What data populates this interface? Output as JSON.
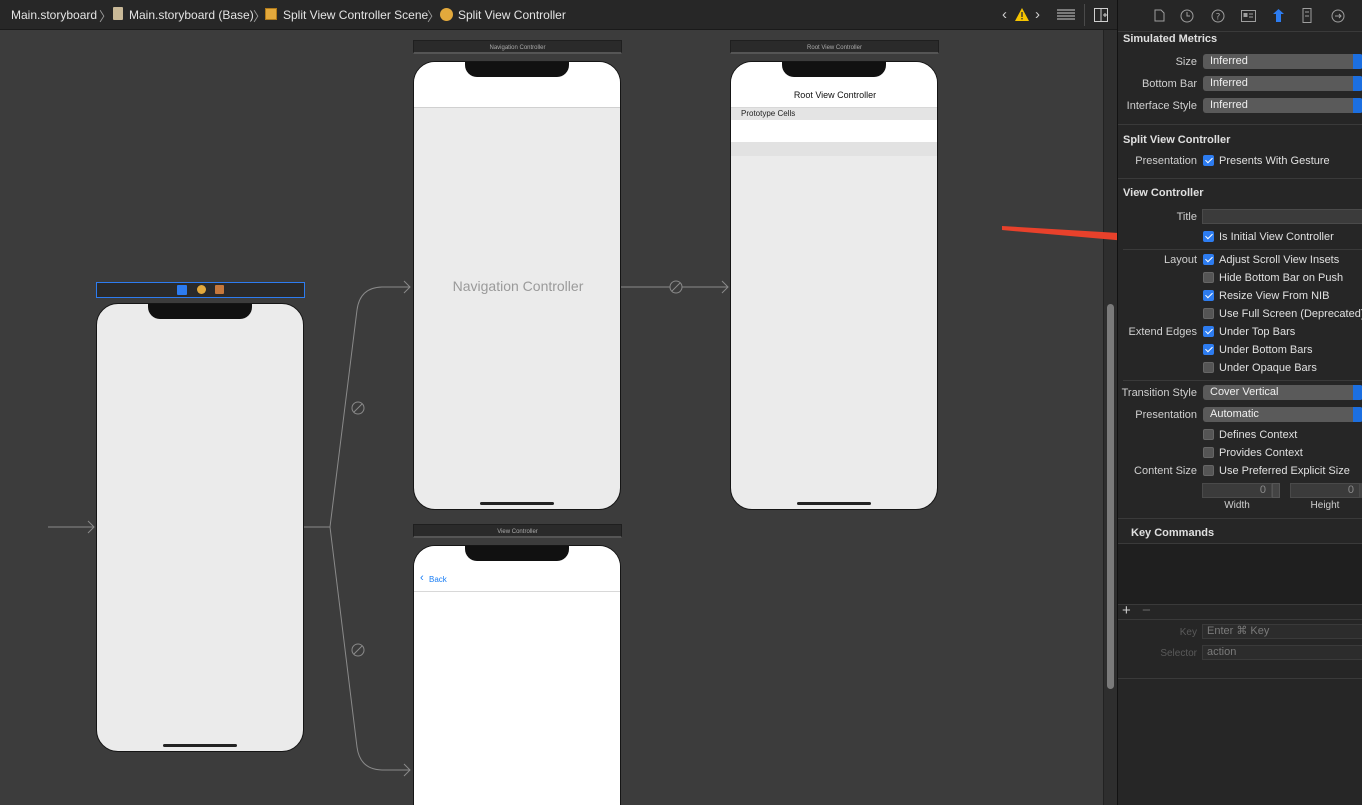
{
  "breadcrumb": {
    "items": [
      "Main.storyboard",
      "Main.storyboard (Base)",
      "Split View Controller Scene",
      "Split View Controller"
    ]
  },
  "canvas": {
    "scenes": {
      "navigation_controller": {
        "title": "Navigation Controller",
        "body_label": "Navigation Controller"
      },
      "root_view_controller": {
        "title": "Root View Controller",
        "nav_title": "Root View Controller",
        "section": "Prototype Cells"
      },
      "view_controller": {
        "title": "View Controller",
        "back_label": "Back"
      }
    }
  },
  "inspector": {
    "tabs": [
      "file-icon",
      "history-icon",
      "help-icon",
      "identity-icon",
      "attributes-icon",
      "size-icon",
      "connections-icon"
    ],
    "simulated_metrics": {
      "title": "Simulated Metrics",
      "size_label": "Size",
      "size_value": "Inferred",
      "bottom_bar_label": "Bottom Bar",
      "bottom_bar_value": "Inferred",
      "interface_style_label": "Interface Style",
      "interface_style_value": "Inferred"
    },
    "split_view_controller": {
      "title": "Split View Controller",
      "presentation_label": "Presentation",
      "presents_with_gesture": {
        "label": "Presents With Gesture",
        "checked": true
      }
    },
    "view_controller": {
      "title": "View Controller",
      "title_label": "Title",
      "title_value": "",
      "is_initial": {
        "label": "Is Initial View Controller",
        "checked": true
      },
      "layout_label": "Layout",
      "adjust_scroll": {
        "label": "Adjust Scroll View Insets",
        "checked": true
      },
      "hide_bottom_bar": {
        "label": "Hide Bottom Bar on Push",
        "checked": false
      },
      "resize_view": {
        "label": "Resize View From NIB",
        "checked": true
      },
      "full_screen": {
        "label": "Use Full Screen (Deprecated)",
        "checked": false
      },
      "extend_edges_label": "Extend Edges",
      "under_top": {
        "label": "Under Top Bars",
        "checked": true
      },
      "under_bottom": {
        "label": "Under Bottom Bars",
        "checked": true
      },
      "under_opaque": {
        "label": "Under Opaque Bars",
        "checked": false
      },
      "transition_style_label": "Transition Style",
      "transition_style_value": "Cover Vertical",
      "presentation_label": "Presentation",
      "presentation_value": "Automatic",
      "defines_context": {
        "label": "Defines Context",
        "checked": false
      },
      "provides_context": {
        "label": "Provides Context",
        "checked": false
      },
      "content_size_label": "Content Size",
      "use_preferred": {
        "label": "Use Preferred Explicit Size",
        "checked": false
      },
      "width_value": "0",
      "height_value": "0",
      "width_label": "Width",
      "height_label": "Height"
    },
    "key_commands": {
      "title": "Key Commands",
      "key_label": "Key",
      "key_placeholder": "Enter ⌘ Key",
      "selector_label": "Selector",
      "selector_placeholder": "action"
    }
  },
  "colors": {
    "accent": "#2d7cf0",
    "annotation_arrow": "#e8412b",
    "warning": "#f5c400"
  }
}
